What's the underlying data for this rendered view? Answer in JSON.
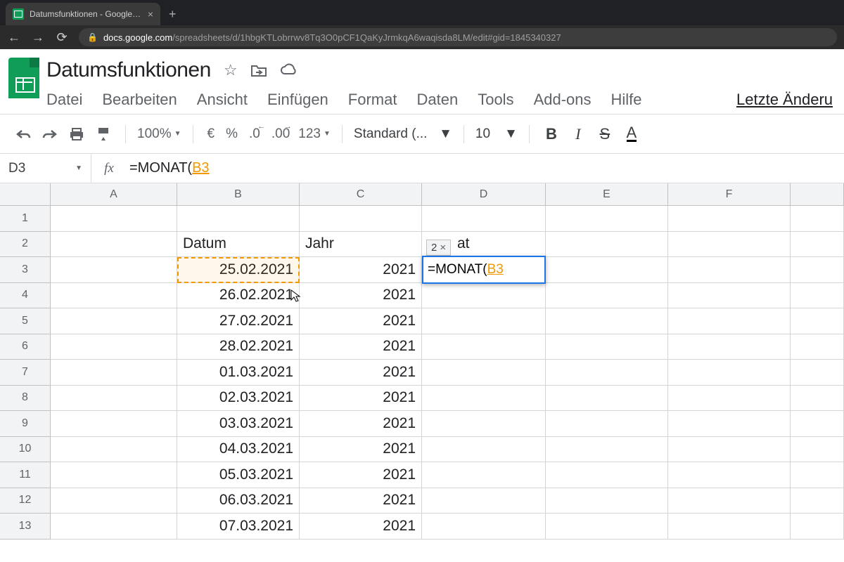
{
  "browser": {
    "tab_title": "Datumsfunktionen - Google Tabe",
    "url_domain": "docs.google.com",
    "url_path": "/spreadsheets/d/1hbgKTLobrrwv8Tq3O0pCF1QaKyJrmkqA6waqisda8LM/edit#gid=1845340327"
  },
  "doc": {
    "title": "Datumsfunktionen",
    "menu": [
      "Datei",
      "Bearbeiten",
      "Ansicht",
      "Einfügen",
      "Format",
      "Daten",
      "Tools",
      "Add-ons",
      "Hilfe"
    ],
    "last_edit": "Letzte Änderu"
  },
  "toolbar": {
    "zoom": "100%",
    "currency": "€",
    "percent": "%",
    "dec_less": ".0",
    "dec_more": ".00",
    "num_format": "123",
    "font": "Standard (...",
    "size": "10"
  },
  "formula": {
    "name_box": "D3",
    "text_prefix": "=MONAT(",
    "text_ref": "B3"
  },
  "hint": {
    "value": "2",
    "close": "×"
  },
  "edit": {
    "prefix": "=MONAT(",
    "ref": "B3"
  },
  "columns": [
    "A",
    "B",
    "C",
    "D",
    "E",
    "F"
  ],
  "rows": [
    "1",
    "2",
    "3",
    "4",
    "5",
    "6",
    "7",
    "8",
    "9",
    "10",
    "11",
    "12",
    "13"
  ],
  "headers": {
    "b": "Datum",
    "c": "Jahr",
    "d_partial": "at"
  },
  "table": [
    {
      "b": "25.02.2021",
      "c": "2021"
    },
    {
      "b": "26.02.2021",
      "c": "2021"
    },
    {
      "b": "27.02.2021",
      "c": "2021"
    },
    {
      "b": "28.02.2021",
      "c": "2021"
    },
    {
      "b": "01.03.2021",
      "c": "2021"
    },
    {
      "b": "02.03.2021",
      "c": "2021"
    },
    {
      "b": "03.03.2021",
      "c": "2021"
    },
    {
      "b": "04.03.2021",
      "c": "2021"
    },
    {
      "b": "05.03.2021",
      "c": "2021"
    },
    {
      "b": "06.03.2021",
      "c": "2021"
    },
    {
      "b": "07.03.2021",
      "c": "2021"
    }
  ]
}
